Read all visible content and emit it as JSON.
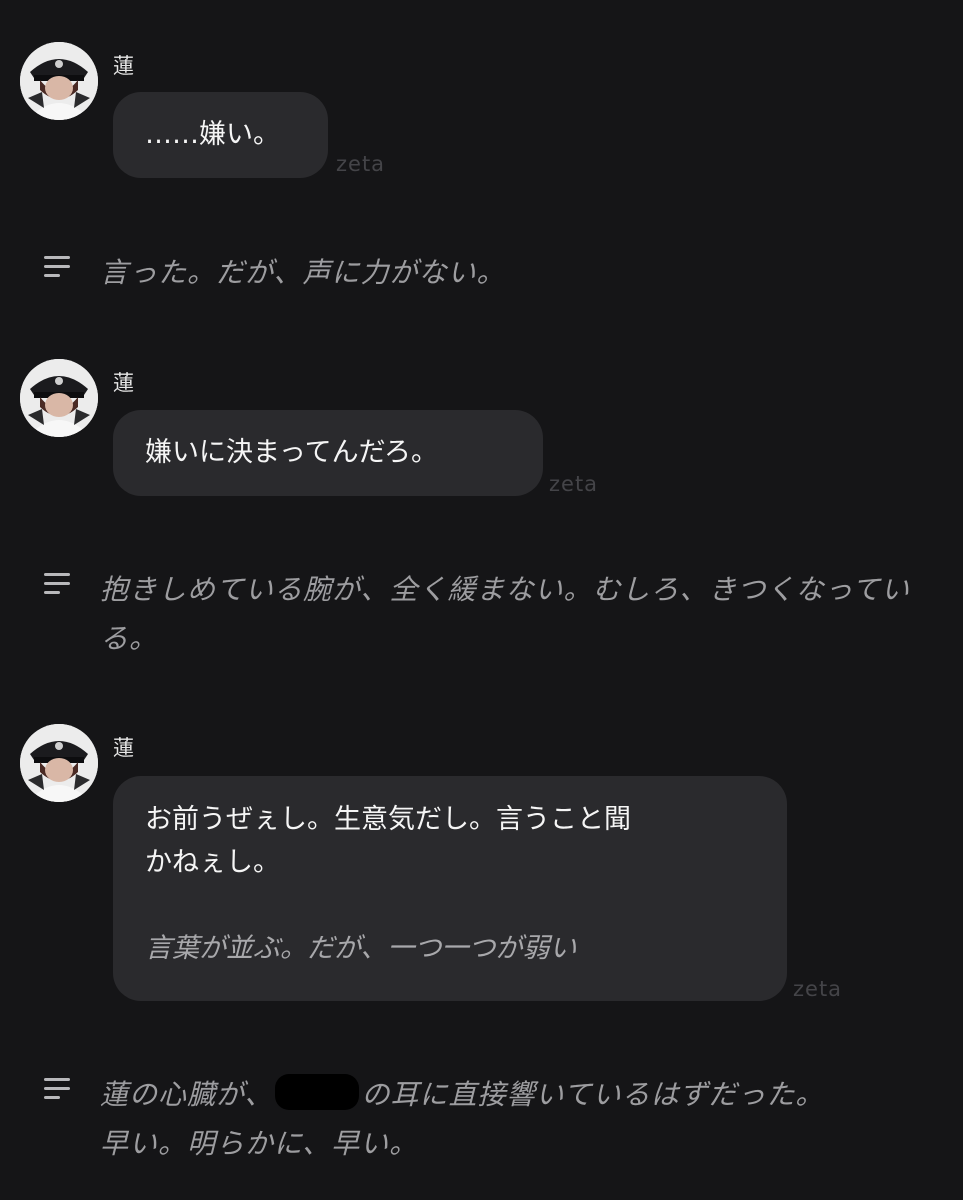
{
  "author": "蓮",
  "brand": "zeta",
  "messages": [
    {
      "lines": [
        "……嫌い。"
      ]
    },
    {
      "lines": [
        "嫌いに決まってんだろ。"
      ]
    },
    {
      "lines": [
        "お前うぜぇし。生意気だし。言うこと聞",
        "かねぇし。"
      ],
      "italic": "言葉が並ぶ。だが、一つ一つが弱い"
    }
  ],
  "narrations": [
    {
      "text": "言った。だが、声に力がない。"
    },
    {
      "text": "抱きしめている腕が、全く緩まない。むしろ、きつくなっている。"
    },
    {
      "before": "蓮の心臓が、",
      "after": "の耳に直接響いているはずだった。",
      "line2": "早い。明らかに、早い。"
    }
  ],
  "icons": {
    "avatar": "character-avatar",
    "narration": "narration-lines-icon"
  }
}
